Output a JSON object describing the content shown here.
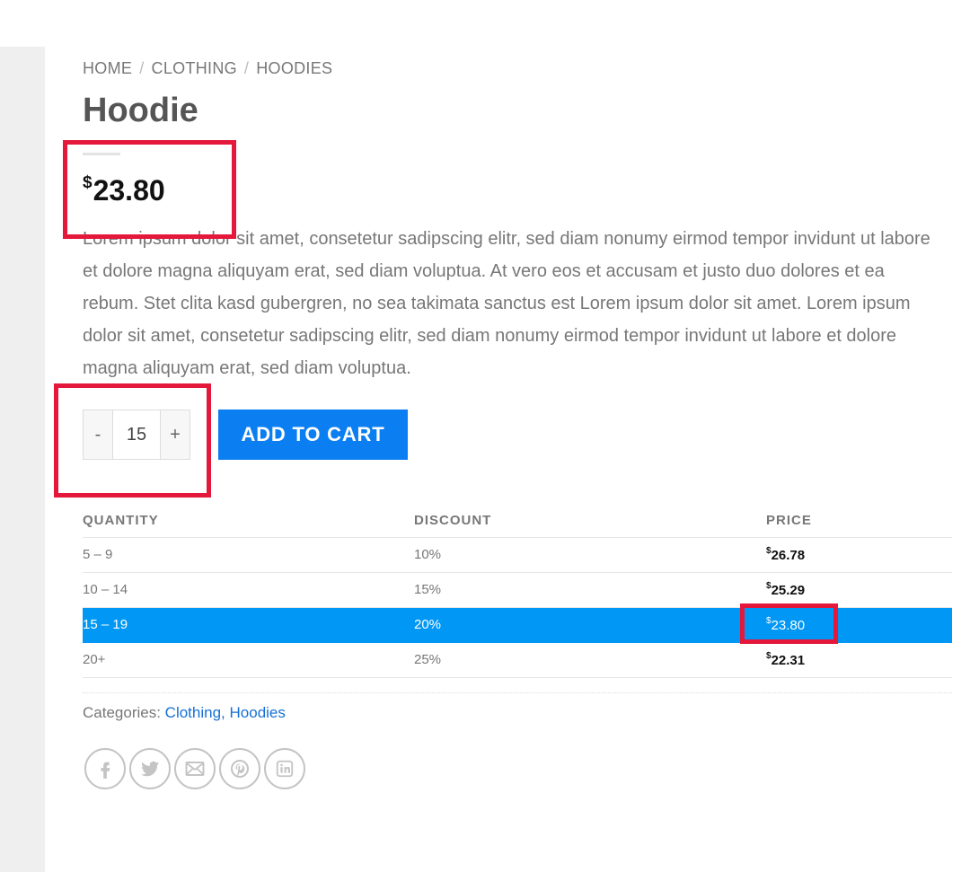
{
  "breadcrumb": {
    "items": [
      "HOME",
      "CLOTHING",
      "HOODIES"
    ],
    "separator": "/"
  },
  "product": {
    "title": "Hoodie",
    "price_currency": "$",
    "price_value": "23.80",
    "description": "Lorem ipsum dolor sit amet, consetetur sadipscing elitr, sed diam nonumy eirmod tempor invidunt ut labore et dolore magna aliquyam erat, sed diam voluptua. At vero eos et accusam et justo duo dolores et ea rebum. Stet clita kasd gubergren, no sea takimata sanctus est Lorem ipsum dolor sit amet. Lorem ipsum dolor sit amet, consetetur sadipscing elitr, sed diam nonumy eirmod tempor invidunt ut labore et dolore magna aliquyam erat, sed diam voluptua."
  },
  "quantity": {
    "minus": "-",
    "value": "15",
    "plus": "+"
  },
  "add_to_cart_label": "ADD TO CART",
  "pricing_table": {
    "headers": [
      "QUANTITY",
      "DISCOUNT",
      "PRICE"
    ],
    "rows": [
      {
        "qty": "5 – 9",
        "discount": "10%",
        "currency": "$",
        "price": "26.78"
      },
      {
        "qty": "10 – 14",
        "discount": "15%",
        "currency": "$",
        "price": "25.29"
      },
      {
        "qty": "15 – 19",
        "discount": "20%",
        "currency": "$",
        "price": "23.80"
      },
      {
        "qty": "20+",
        "discount": "25%",
        "currency": "$",
        "price": "22.31"
      }
    ],
    "active_row": 2
  },
  "categories": {
    "label": "Categories:",
    "links": [
      "Clothing",
      "Hoodies"
    ],
    "separator": ","
  },
  "share_icons": [
    "facebook-icon",
    "twitter-icon",
    "email-icon",
    "pinterest-icon",
    "linkedin-icon"
  ],
  "colors": {
    "accent": "#0b7ff2",
    "active_row": "#0097f5",
    "highlight": "#e3183b",
    "link": "#1670d6"
  }
}
